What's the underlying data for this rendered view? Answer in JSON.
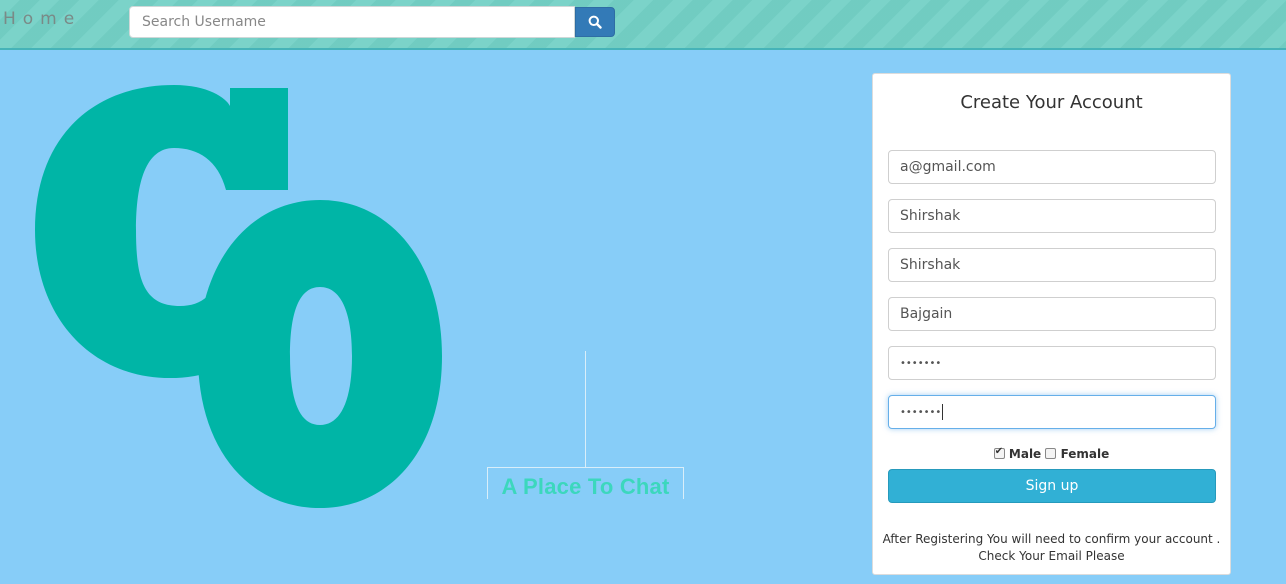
{
  "navbar": {
    "brand": "Home",
    "search": {
      "placeholder": "Search Username",
      "value": ""
    },
    "search_icon": "search-icon"
  },
  "logo": {
    "letters": "co",
    "color": "#00b5a6"
  },
  "tagline": "A Place To Chat",
  "form": {
    "title": "Create Your Account",
    "email": "a@gmail.com",
    "username": "Shirshak",
    "first_name": "Shirshak",
    "last_name": "Bajgain",
    "password": "•••••••",
    "confirm_password": "•••••••",
    "gender": {
      "male_label": "Male",
      "female_label": "Female",
      "selected": "Male"
    },
    "signup_label": "Sign up",
    "note_line1": "After Registering You will need to confirm your account .",
    "note_line2": "Check Your Email Please"
  },
  "colors": {
    "background": "#87cdf8",
    "navbar": "#74d1c6",
    "accent": "#31b0d5",
    "search_button": "#337ab7",
    "logo": "#00b5a6"
  }
}
